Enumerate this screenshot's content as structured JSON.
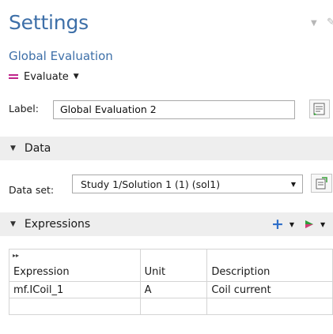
{
  "header": {
    "title": "Settings",
    "subtitle": "Global Evaluation",
    "evaluate_label": "Evaluate"
  },
  "label_field": {
    "caption": "Label:",
    "value": "Global Evaluation 2"
  },
  "data_section": {
    "title": "Data",
    "dataset_caption": "Data set:",
    "dataset_value": "Study 1/Solution 1 (1) (sol1)"
  },
  "expressions_section": {
    "title": "Expressions",
    "columns": [
      "Expression",
      "Unit",
      "Description"
    ],
    "rows": [
      [
        "mf.ICoil_1",
        "A",
        "Coil current"
      ],
      [
        "",
        "",
        ""
      ]
    ]
  },
  "colors": {
    "title_blue": "#3d6fa8",
    "evaluate_icon": "#c0248b",
    "add_icon": "#2f6fc9",
    "section_bg": "#eeeeee"
  },
  "icons": [
    "pin-icon",
    "equals-icon",
    "label-edit-icon",
    "dataset-icon",
    "add-icon",
    "plot-icon",
    "sort-icon"
  ]
}
